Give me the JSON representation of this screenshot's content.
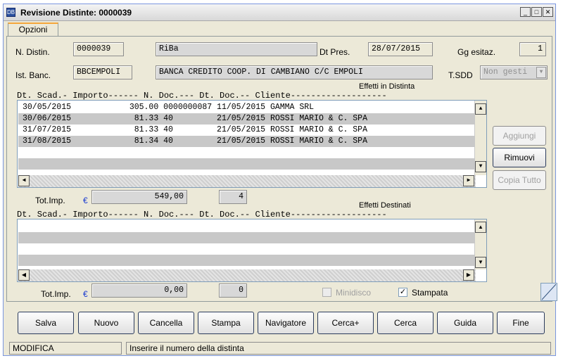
{
  "window": {
    "title": "Revisione Distinte: 0000039",
    "icon_text": "DB",
    "minimize": "_",
    "maximize": "□",
    "close": "✕"
  },
  "tabs": [
    {
      "label": "Opzioni"
    }
  ],
  "header": {
    "n_distin_label": "N. Distin.",
    "n_distin_value": "0000039",
    "tipo_value": "RiBa",
    "dt_pres_label": "Dt Pres.",
    "dt_pres_value": "28/07/2015",
    "gg_esitaz_label": "Gg esitaz.",
    "gg_esitaz_value": "1",
    "ist_banc_label": "Ist. Banc.",
    "ist_banc_code": "BBCEMPOLI",
    "ist_banc_name": "BANCA CREDITO COOP. DI CAMBIANO C/C EMPOLI",
    "tsdd_label": "T.SDD",
    "tsdd_value": "Non gesti"
  },
  "effetti_distinta": {
    "title": "Effetti in Distinta",
    "columns_header": "Dt. Scad.-      Importo------ N. Doc.--- Dt. Doc.-- Cliente-------------------",
    "rows": [
      {
        "text": "30/05/2015            305.00 0000000087 11/05/2015 GAMMA SRL"
      },
      {
        "text": "30/06/2015             81.33 40         21/05/2015 ROSSI MARIO & C. SPA"
      },
      {
        "text": "31/07/2015             81.33 40         21/05/2015 ROSSI MARIO & C. SPA"
      },
      {
        "text": "31/08/2015             81.34 40         21/05/2015 ROSSI MARIO & C. SPA"
      }
    ],
    "tot_label": "Tot.Imp.",
    "currency": "€",
    "tot_value": "549,00",
    "count": "4"
  },
  "effetti_destinati": {
    "title": "Effetti Destinati",
    "columns_header": "Dt. Scad.-      Importo------ N. Doc.--- Dt. Doc.-- Cliente-------------------",
    "tot_label": "Tot.Imp.",
    "currency": "€",
    "tot_value": "0,00",
    "count": "0"
  },
  "side_buttons": {
    "aggiungi": "Aggiungi",
    "rimuovi": "Rimuovi",
    "copia_tutto": "Copia Tutto"
  },
  "options": {
    "minidisco_label": "Minidisco",
    "minidisco_checked": false,
    "stampata_label": "Stampata",
    "stampata_checked": true
  },
  "toolbar": {
    "salva": "Salva",
    "nuovo": "Nuovo",
    "cancella": "Cancella",
    "stampa": "Stampa",
    "navigatore": "Navigatore",
    "cerca_plus": "Cerca+",
    "cerca": "Cerca",
    "guida": "Guida",
    "fine": "Fine"
  },
  "status": {
    "mode": "MODIFICA",
    "message": "Inserire il numero della distinta"
  }
}
